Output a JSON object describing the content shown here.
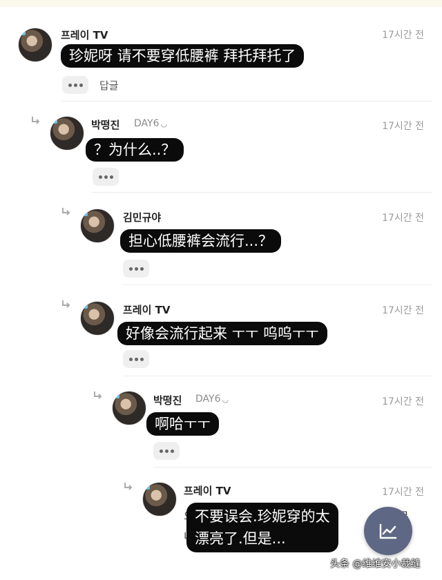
{
  "comments": [
    {
      "author": "프레이 TV",
      "time": "17시간 전",
      "text": "珍妮呀 请不要穿低腰裤 拜托拜托了",
      "reply_label": "답글"
    },
    {
      "author": "박떵진",
      "tag": "DAY6",
      "time": "17시간 전",
      "text": "？为什么..？"
    },
    {
      "author": "김민규야",
      "time": "17시간 전",
      "text": "担心低腰裤会流行...？"
    },
    {
      "author": "프레이 TV",
      "time": "17시간 전",
      "text": "好像会流行起来 ㅜㅜ 呜呜ㅜㅜ"
    },
    {
      "author": "박떵진",
      "tag": "DAY6",
      "time": "17시간 전",
      "text": "啊哈ㅜㅜ"
    },
    {
      "author": "프레이 TV",
      "time": "17시간 전",
      "text_line1": "不要误会.珍妮穿的太",
      "text_line2": "漂亮了.但是...",
      "partial_left_1": "오",
      "partial_left_2": "니",
      "partial_right": "무너무"
    }
  ],
  "icons": {
    "more": "more-dots-icon",
    "reply": "reply-arrow-icon",
    "fab": "chart-trend-icon",
    "tag_mark": "smile-icon"
  },
  "tag_mark_glyph": "◡",
  "watermark": "头条 @维维安小裁缝",
  "colors": {
    "bubble": "#0b0b0b",
    "fab": "#5e6783",
    "badge": "#6bc3e8"
  }
}
